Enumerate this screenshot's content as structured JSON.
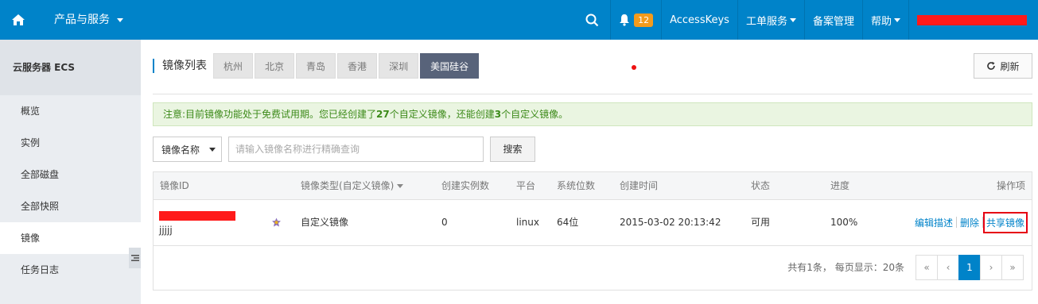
{
  "topbar": {
    "products_label": "产品与服务",
    "notifications_count": "12",
    "accesskeys": "AccessKeys",
    "tickets": "工单服务",
    "beian": "备案管理",
    "help": "帮助"
  },
  "sidebar": {
    "title": "云服务器 ECS",
    "items": [
      {
        "label": "概览"
      },
      {
        "label": "实例"
      },
      {
        "label": "全部磁盘"
      },
      {
        "label": "全部快照"
      },
      {
        "label": "镜像"
      },
      {
        "label": "任务日志"
      }
    ]
  },
  "main": {
    "title": "镜像列表",
    "regions": [
      "杭州",
      "北京",
      "青岛",
      "香港",
      "深圳",
      "美国硅谷"
    ],
    "active_region": "美国硅谷",
    "refresh_label": "刷新",
    "notice": {
      "prefix": "注意:目前镜像功能处于免费试用期。您已经创建了",
      "created": "27",
      "middle": "个自定义镜像，还能创建",
      "remaining": "3",
      "suffix": "个自定义镜像。"
    },
    "search": {
      "select_value": "镜像名称",
      "placeholder": "请输入镜像名称进行精确查询",
      "button": "搜索"
    },
    "table": {
      "headers": {
        "id": "镜像ID",
        "type": "镜像类型(自定义镜像)",
        "instances": "创建实例数",
        "platform": "平台",
        "bits": "系统位数",
        "created_at": "创建时间",
        "status": "状态",
        "progress": "进度",
        "actions": "操作项"
      },
      "rows": [
        {
          "name": "jjjjj",
          "type": "自定义镜像",
          "instances": "0",
          "platform": "linux",
          "bits": "64位",
          "created_at": "2015-03-02 20:13:42",
          "status": "可用",
          "progress": "100%",
          "actions": {
            "edit": "编辑描述",
            "delete": "删除",
            "share": "共享镜像"
          }
        }
      ]
    },
    "pagination": {
      "summary": "共有1条， 每页显示：20条",
      "first": "«",
      "prev": "‹",
      "current": "1",
      "next": "›",
      "last": "»"
    }
  },
  "colors": {
    "topbar": "#0083c9",
    "active_region": "#58637a",
    "badge": "#f39b1c",
    "notice_text": "#3c8a19",
    "highlight_box": "#e60012",
    "redaction": "#ff1a1a"
  }
}
